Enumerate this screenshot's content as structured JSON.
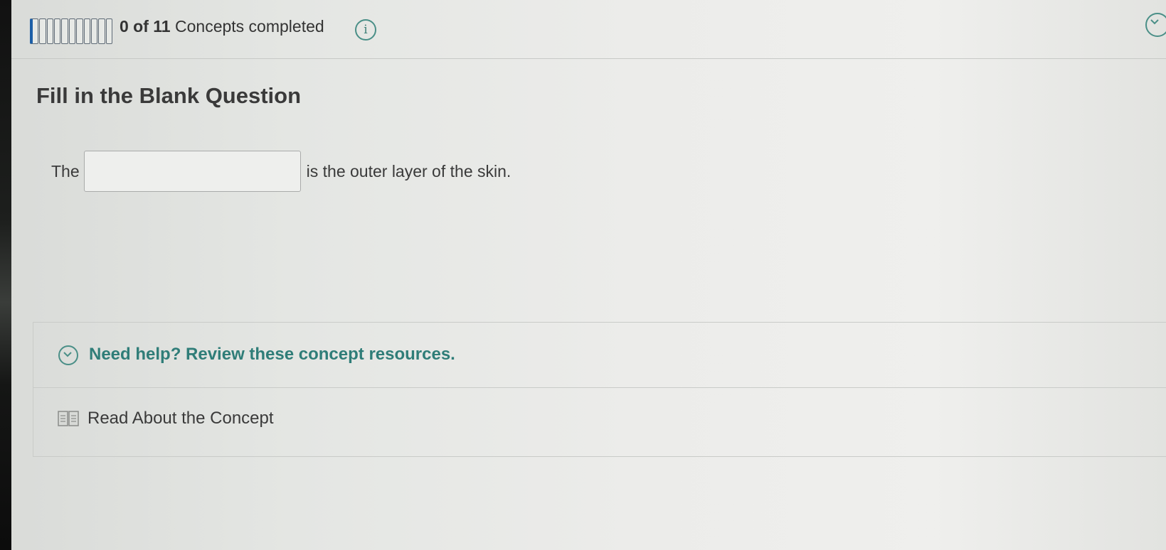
{
  "progress": {
    "total_segments": 11,
    "completed_segments": 0,
    "count": "0 of 11",
    "label": "Concepts completed"
  },
  "info_icon": {
    "icon": "info-icon",
    "glyph": "i"
  },
  "corner_icon": {
    "icon": "chevron-down-circle-icon"
  },
  "question": {
    "title": "Fill in the Blank Question",
    "before_blank": "The",
    "after_blank": "is the outer layer of the skin.",
    "blank_value": ""
  },
  "resources": {
    "toggle_label": "Need help? Review these concept resources.",
    "toggle_icon": "chevron-down-circle-icon",
    "read_label": "Read About the Concept",
    "read_icon": "book-icon"
  },
  "colors": {
    "accent_teal": "#2f7d78",
    "progress_blue": "#1d5fa7"
  }
}
